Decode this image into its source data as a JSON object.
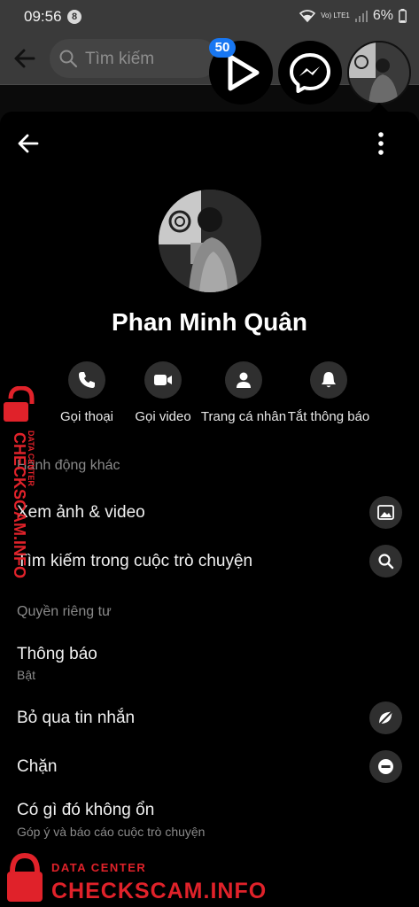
{
  "status_bar": {
    "time": "09:56",
    "notification_count": "8",
    "network": "Vo) LTE1",
    "battery": "6%"
  },
  "app_bar": {
    "search_placeholder": "Tìm kiếm"
  },
  "chat_heads": {
    "video_badge": "50"
  },
  "profile": {
    "name": "Phan Minh Quân"
  },
  "quick_actions": [
    {
      "label": "Gọi thoại",
      "icon": "phone-icon"
    },
    {
      "label": "Gọi video",
      "icon": "video-camera-icon"
    },
    {
      "label": "Trang cá nhân",
      "icon": "person-icon"
    },
    {
      "label": "Tắt thông báo",
      "icon": "bell-icon"
    }
  ],
  "sections": {
    "other_actions": {
      "title": "Hành động khác",
      "items": [
        {
          "label": "Xem ảnh & video",
          "icon": "image-icon"
        },
        {
          "label": "Tìm kiếm trong cuộc trò chuyện",
          "icon": "search-icon"
        }
      ]
    },
    "privacy": {
      "title": "Quyền riêng tư",
      "items": [
        {
          "label": "Thông báo",
          "sub": "Bật"
        },
        {
          "label": "Bỏ qua tin nhắn",
          "icon": "ignore-icon"
        },
        {
          "label": "Chặn",
          "icon": "block-icon"
        },
        {
          "label": "Có gì đó không ổn",
          "sub": "Góp ý và báo cáo cuộc trò chuyện"
        }
      ]
    }
  },
  "watermark": {
    "line1": "DATA CENTER",
    "line2": "CHECKSCAM.INFO"
  },
  "colors": {
    "background": "#000000",
    "icon_circle": "#2f2f2f",
    "badge_blue": "#1877f2",
    "watermark_red": "#e0222a",
    "secondary_text": "#8a8a8a"
  }
}
